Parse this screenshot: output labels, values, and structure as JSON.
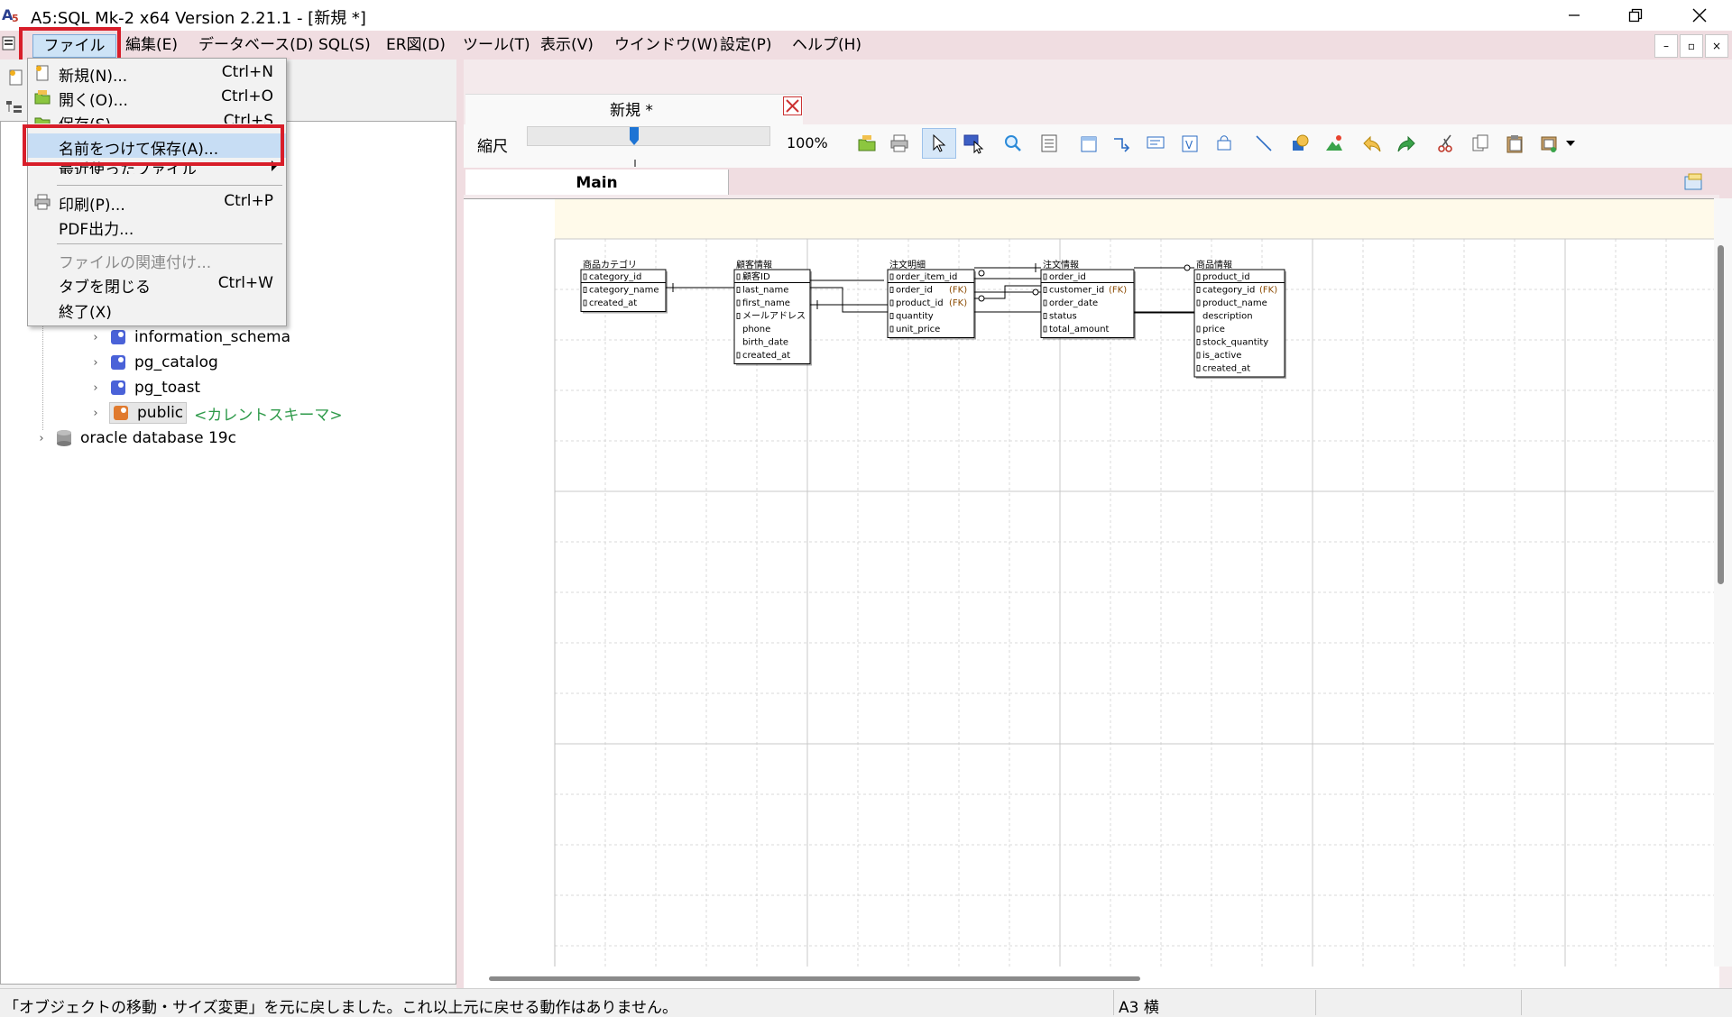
{
  "window": {
    "title": "A5:SQL Mk-2 x64 Version 2.21.1 - [新規 *]"
  },
  "menubar": {
    "items": [
      "ファイル(F)",
      "編集(E)",
      "データベース(D)",
      "SQL(S)",
      "ER図(D)",
      "ツール(T)",
      "表示(V)",
      "ウインドウ(W)",
      "設定(P)",
      "ヘルプ(H)"
    ]
  },
  "file_menu": {
    "items": [
      {
        "label": "新規(N)...",
        "shortcut": "Ctrl+N",
        "icon": "new-file-icon"
      },
      {
        "label": "開く(O)...",
        "shortcut": "Ctrl+O",
        "icon": "open-folder-icon"
      },
      {
        "label": "保存(S)",
        "shortcut": "Ctrl+S",
        "icon": "save-icon"
      },
      {
        "label": "名前をつけて保存(A)...",
        "shortcut": "",
        "icon": ""
      },
      {
        "label": "最近使ったファイル",
        "shortcut": "",
        "icon": ""
      },
      {
        "label": "印刷(P)...",
        "shortcut": "Ctrl+P",
        "icon": "print-icon"
      },
      {
        "label": "PDF出力...",
        "shortcut": "",
        "icon": ""
      },
      {
        "label": "ファイルの関連付け...",
        "shortcut": "",
        "icon": ""
      },
      {
        "label": "タブを閉じる",
        "shortcut": "Ctrl+W",
        "icon": ""
      },
      {
        "label": "終了(X)",
        "shortcut": "",
        "icon": ""
      }
    ]
  },
  "tree": {
    "items": [
      {
        "label": "information_schema",
        "note": ""
      },
      {
        "label": "pg_catalog",
        "note": ""
      },
      {
        "label": "pg_toast",
        "note": ""
      },
      {
        "label": "public",
        "note": "<カレントスキーマ>"
      },
      {
        "label": "oracle database 19c",
        "note": ""
      }
    ]
  },
  "editor": {
    "tab_title": "新規 *",
    "scale_label": "縮尺",
    "zoom": "100%",
    "page_tab": "Main"
  },
  "er": {
    "entities": [
      {
        "name": "商品カテゴリ",
        "columns": [
          {
            "name": "category_id",
            "fk": false,
            "key": true
          },
          {
            "name": "category_name",
            "fk": false,
            "key": true
          },
          {
            "name": "created_at",
            "fk": false,
            "key": true
          }
        ]
      },
      {
        "name": "顧客情報",
        "columns": [
          {
            "name": "顧客ID",
            "fk": false,
            "key": true
          },
          {
            "name": "last_name",
            "fk": false,
            "key": true
          },
          {
            "name": "first_name",
            "fk": false,
            "key": true
          },
          {
            "name": "メールアドレス",
            "fk": false,
            "key": true
          },
          {
            "name": "phone",
            "fk": false,
            "key": false
          },
          {
            "name": "birth_date",
            "fk": false,
            "key": false
          },
          {
            "name": "created_at",
            "fk": false,
            "key": true
          }
        ]
      },
      {
        "name": "注文明細",
        "columns": [
          {
            "name": "order_item_id",
            "fk": false,
            "key": true
          },
          {
            "name": "order_id",
            "fk": true,
            "key": true
          },
          {
            "name": "product_id",
            "fk": true,
            "key": true
          },
          {
            "name": "quantity",
            "fk": false,
            "key": true
          },
          {
            "name": "unit_price",
            "fk": false,
            "key": true
          }
        ]
      },
      {
        "name": "注文情報",
        "columns": [
          {
            "name": "order_id",
            "fk": false,
            "key": true
          },
          {
            "name": "customer_id",
            "fk": true,
            "key": true
          },
          {
            "name": "order_date",
            "fk": false,
            "key": true
          },
          {
            "name": "status",
            "fk": false,
            "key": true
          },
          {
            "name": "total_amount",
            "fk": false,
            "key": true
          }
        ]
      },
      {
        "name": "商品情報",
        "columns": [
          {
            "name": "product_id",
            "fk": false,
            "key": true
          },
          {
            "name": "category_id",
            "fk": true,
            "key": true
          },
          {
            "name": "product_name",
            "fk": false,
            "key": true
          },
          {
            "name": "description",
            "fk": false,
            "key": false
          },
          {
            "name": "price",
            "fk": false,
            "key": true
          },
          {
            "name": "stock_quantity",
            "fk": false,
            "key": true
          },
          {
            "name": "is_active",
            "fk": false,
            "key": true
          },
          {
            "name": "created_at",
            "fk": false,
            "key": true
          }
        ]
      }
    ],
    "fk_label": "(FK)"
  },
  "status": {
    "message": "「オブジェクトの移動・サイズ変更」を元に戻しました。これ以上元に戻せる動作はありません。",
    "paper": "A3 横"
  },
  "colors": {
    "menubar_bg": "#f0dde1",
    "highlight_red": "#d81e2a",
    "selected_item": "#c7ddf4",
    "schema_note": "#2e9a4a"
  }
}
